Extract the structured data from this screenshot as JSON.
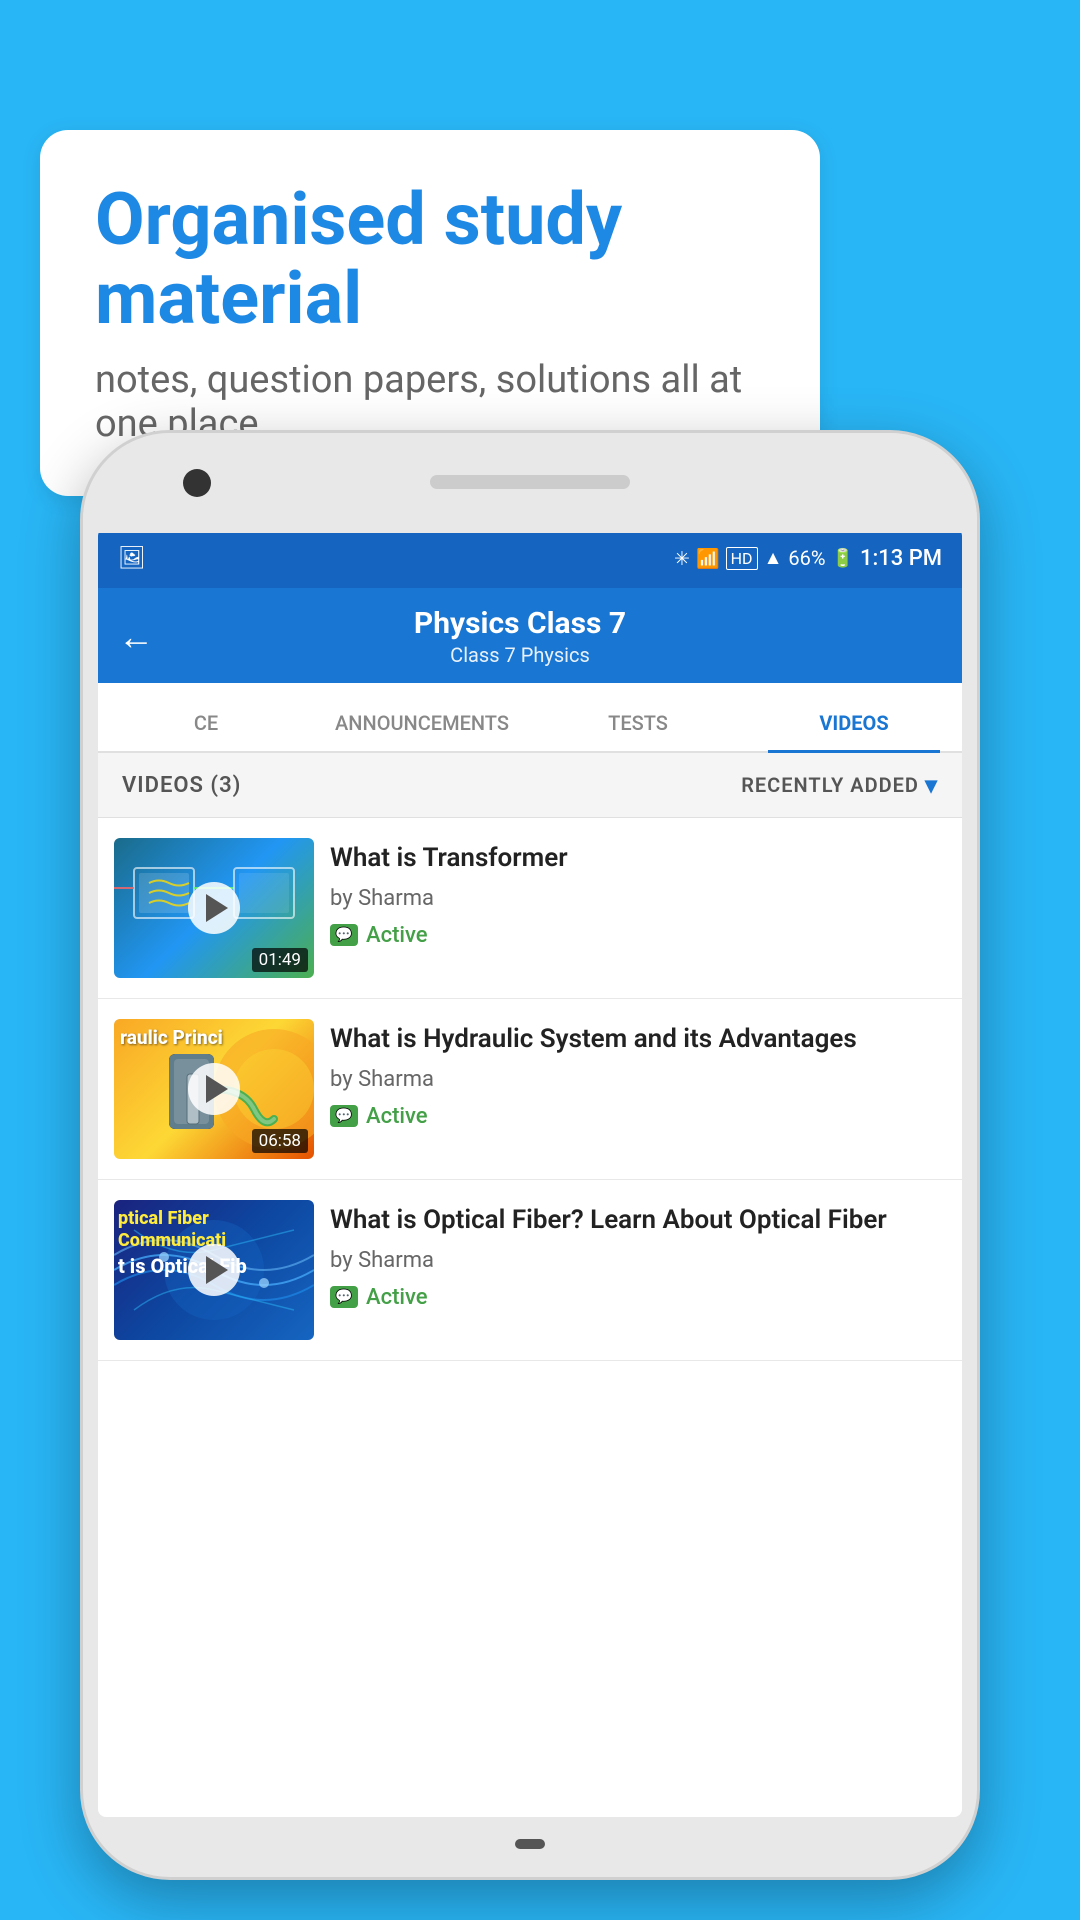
{
  "background_color": "#29b6f6",
  "speech_bubble": {
    "title": "Organised study material",
    "subtitle": "notes, question papers, solutions all at one place"
  },
  "status_bar": {
    "battery_percent": "66%",
    "time": "1:13 PM"
  },
  "app_header": {
    "title": "Physics Class 7",
    "subtitle": "Class 7    Physics",
    "back_label": "←"
  },
  "tabs": [
    {
      "label": "CE",
      "active": false
    },
    {
      "label": "ANNOUNCEMENTS",
      "active": false
    },
    {
      "label": "TESTS",
      "active": false
    },
    {
      "label": "VIDEOS",
      "active": true
    }
  ],
  "list_header": {
    "count_label": "VIDEOS (3)",
    "sort_label": "RECENTLY ADDED"
  },
  "videos": [
    {
      "title": "What is  Transformer",
      "author": "by Sharma",
      "status": "Active",
      "duration": "01:49",
      "thumb_type": "transformer"
    },
    {
      "title": "What is Hydraulic System and its Advantages",
      "author": "by Sharma",
      "status": "Active",
      "duration": "06:58",
      "thumb_type": "hydraulic"
    },
    {
      "title": "What is Optical Fiber? Learn About Optical Fiber",
      "author": "by Sharma",
      "status": "Active",
      "duration": "",
      "thumb_type": "optical"
    }
  ],
  "icons": {
    "play": "▶",
    "dropdown": "▾",
    "back": "←",
    "chat": "💬"
  }
}
